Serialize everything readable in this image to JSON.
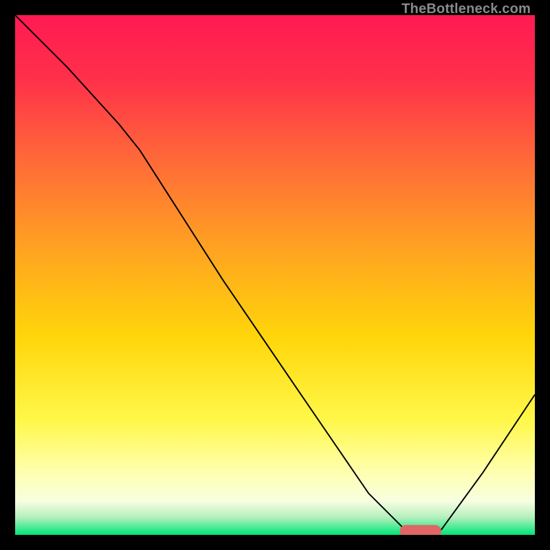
{
  "watermark": "TheBottleneck.com",
  "chart_data": {
    "type": "line",
    "title": "",
    "xlabel": "",
    "ylabel": "",
    "xlim": [
      0,
      100
    ],
    "ylim": [
      0,
      100
    ],
    "grid": false,
    "legend": false,
    "background_gradient": {
      "stops": [
        {
          "offset": 0.0,
          "color": "#ff1a53"
        },
        {
          "offset": 0.12,
          "color": "#ff2f4a"
        },
        {
          "offset": 0.28,
          "color": "#ff6a38"
        },
        {
          "offset": 0.45,
          "color": "#ffa321"
        },
        {
          "offset": 0.62,
          "color": "#ffd60a"
        },
        {
          "offset": 0.78,
          "color": "#fff84a"
        },
        {
          "offset": 0.88,
          "color": "#ffffb0"
        },
        {
          "offset": 0.935,
          "color": "#f7ffe0"
        },
        {
          "offset": 0.965,
          "color": "#b8f0c0"
        },
        {
          "offset": 1.0,
          "color": "#00e676"
        }
      ]
    },
    "series": [
      {
        "name": "bottleneck-curve",
        "color": "#000000",
        "x": [
          0,
          10,
          20,
          24,
          40,
          55,
          68,
          75,
          78,
          82,
          90,
          100
        ],
        "y": [
          100,
          90,
          79,
          74,
          49,
          27,
          8,
          1,
          0,
          1,
          12,
          27
        ]
      }
    ],
    "marker": {
      "name": "optimal-segment",
      "color": "#e06666",
      "x_start": 74,
      "x_end": 82,
      "y": 0.7,
      "thickness": 2.4
    }
  }
}
